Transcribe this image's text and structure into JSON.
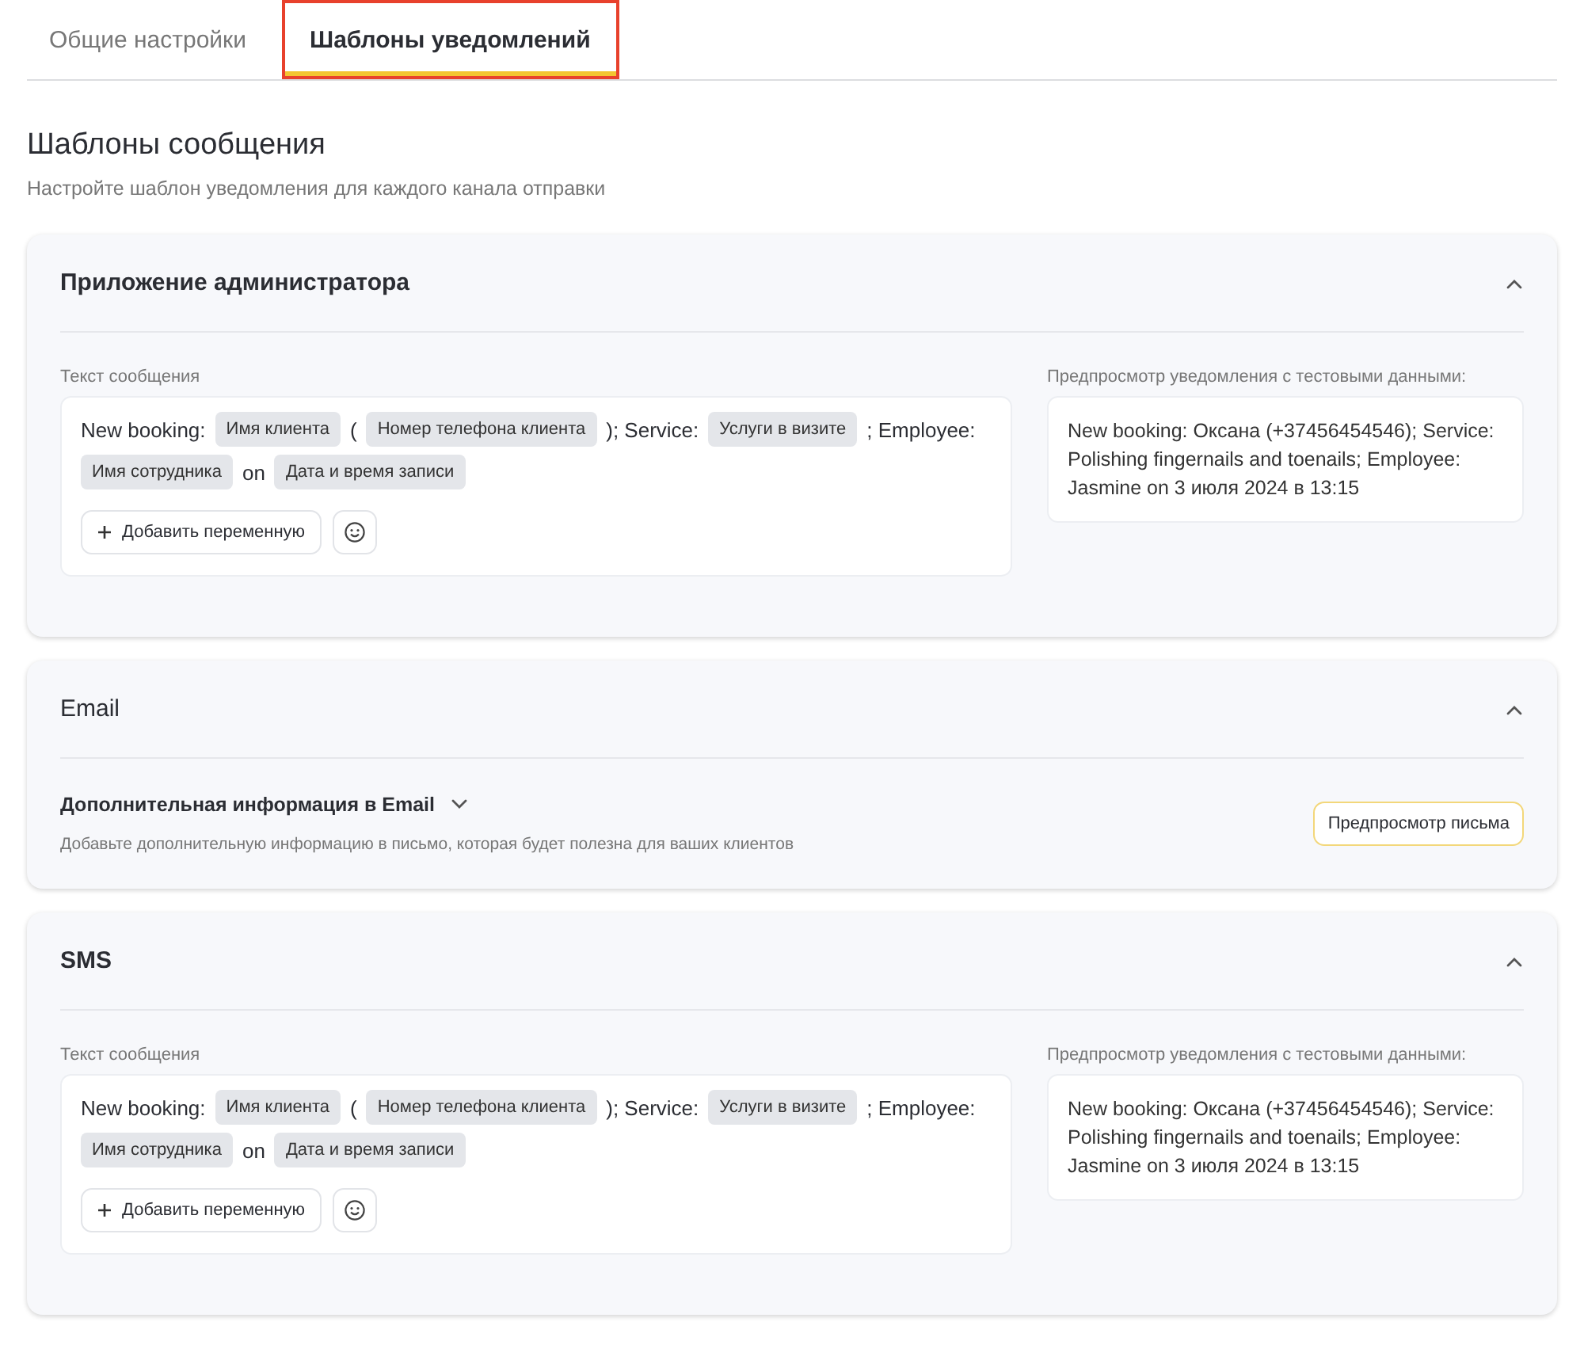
{
  "tabs": [
    {
      "label": "Общие настройки",
      "selected": false
    },
    {
      "label": "Шаблоны уведомлений",
      "selected": true
    }
  ],
  "heading": "Шаблоны сообщения",
  "subtitle": "Настройте шаблон уведомления для каждого канала отправки",
  "sections": [
    {
      "kind": "template",
      "title": "Приложение администратора",
      "expanded": true,
      "field_label": "Текст сообщения",
      "parts": [
        {
          "kind": "text",
          "text": "New booking:"
        },
        {
          "kind": "variable",
          "text": "Имя клиента"
        },
        {
          "kind": "text",
          "text": "("
        },
        {
          "kind": "variable",
          "text": "Номер телефона клиента"
        },
        {
          "kind": "text",
          "text": "); Service:"
        },
        {
          "kind": "variable",
          "text": "Услуги в визите"
        },
        {
          "kind": "text",
          "text": "; Employee:"
        },
        {
          "kind": "variable",
          "text": "Имя сотрудника"
        },
        {
          "kind": "text",
          "text": "on"
        },
        {
          "kind": "variable",
          "text": "Дата и время записи"
        }
      ],
      "add_button": "Добавить переменную",
      "preview_label": "Предпросмотр уведомления с тестовыми данными:",
      "preview_text": "New booking: Оксана (+37456454546); Service: Polishing fingernails and toenails; Employee: Jasmine on 3 июля 2024 в 13:15"
    },
    {
      "kind": "email",
      "title": "Email",
      "expanded": true,
      "info_title": "Дополнительная информация в Email",
      "info_expanded": false,
      "info_description": "Добавьте дополнительную информацию в письмо, которая будет полезна для ваших клиентов",
      "preview_button": "Предпросмотр письма"
    },
    {
      "kind": "template",
      "title": "SMS",
      "expanded": true,
      "field_label": "Текст сообщения",
      "parts": [
        {
          "kind": "text",
          "text": "New booking:"
        },
        {
          "kind": "variable",
          "text": "Имя клиента"
        },
        {
          "kind": "text",
          "text": "("
        },
        {
          "kind": "variable",
          "text": "Номер телефона клиента"
        },
        {
          "kind": "text",
          "text": "); Service:"
        },
        {
          "kind": "variable",
          "text": "Услуги в визите"
        },
        {
          "kind": "text",
          "text": "; Employee:"
        },
        {
          "kind": "variable",
          "text": "Имя сотрудника"
        },
        {
          "kind": "text",
          "text": "on"
        },
        {
          "kind": "variable",
          "text": "Дата и время записи"
        }
      ],
      "add_button": "Добавить переменную",
      "preview_label": "Предпросмотр уведомления с тестовыми данными:",
      "preview_text": "New booking: Оксана (+37456454546); Service: Polishing fingernails and toenails; Employee: Jasmine on 3 июля 2024 в 13:15"
    }
  ]
}
